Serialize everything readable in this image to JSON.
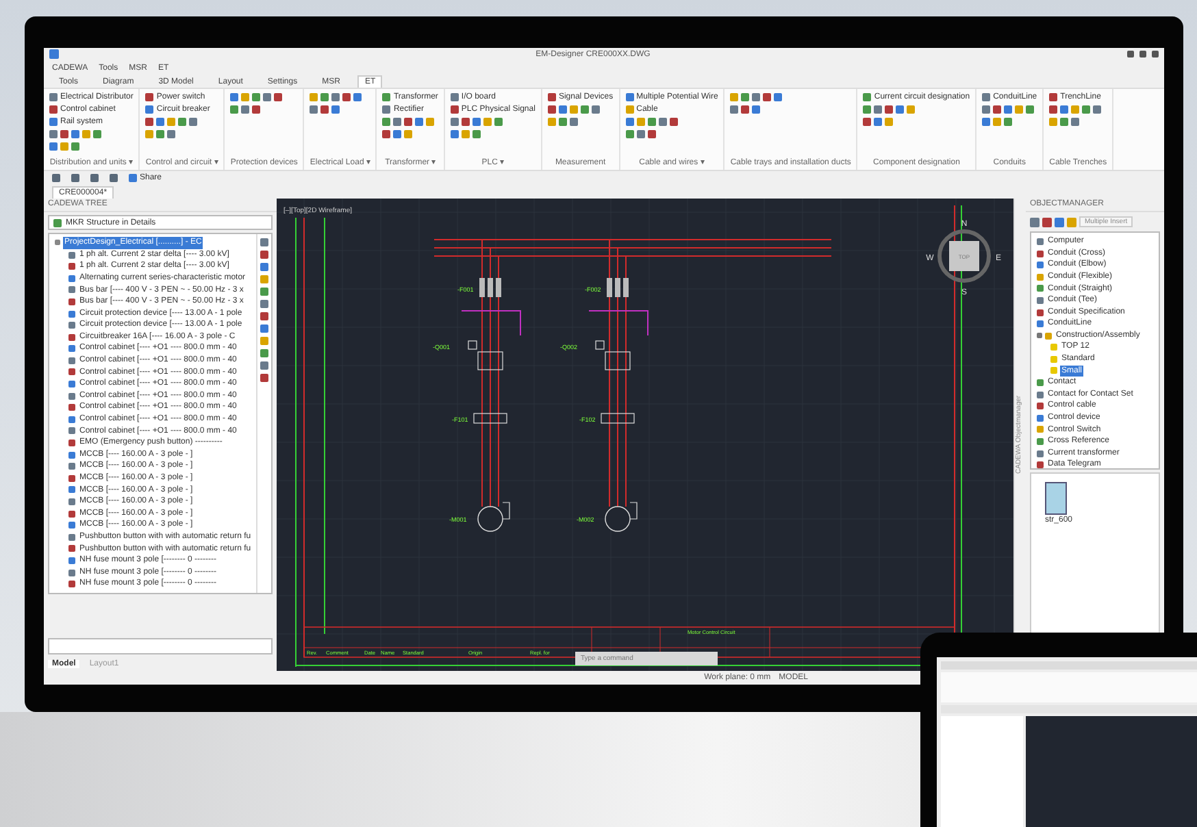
{
  "window": {
    "title": "EM-Designer  CRE000XX.DWG"
  },
  "menu": [
    "CADEWA",
    "Tools",
    "MSR",
    "ET"
  ],
  "ribbon_tabs": [
    {
      "label": "Tools",
      "selected": false
    },
    {
      "label": "Diagram",
      "selected": false
    },
    {
      "label": "3D Model",
      "selected": false
    },
    {
      "label": "Layout",
      "selected": false
    },
    {
      "label": "Settings",
      "selected": false
    },
    {
      "label": "MSR",
      "selected": false
    },
    {
      "label": "ET",
      "selected": true
    }
  ],
  "ribbon_groups": [
    {
      "label": "Distribution and units ▾",
      "items": [
        "Electrical Distributor",
        "Control cabinet",
        "Rail system"
      ]
    },
    {
      "label": "Control and circuit ▾",
      "items": [
        "Power switch",
        "Circuit breaker"
      ]
    },
    {
      "label": "Protection devices"
    },
    {
      "label": "Electrical Load ▾"
    },
    {
      "label": "Transformer ▾",
      "items": [
        "Transformer",
        "Rectifier"
      ]
    },
    {
      "label": "PLC ▾",
      "items": [
        "I/O board",
        "PLC Physical Signal"
      ]
    },
    {
      "label": "Measurement",
      "items": [
        "Signal Devices"
      ]
    },
    {
      "label": "Cable and wires ▾",
      "items": [
        "Multiple Potential Wire",
        "Cable"
      ]
    },
    {
      "label": "Cable trays and installation ducts"
    },
    {
      "label": "Component designation",
      "items": [
        "Current circuit designation"
      ]
    },
    {
      "label": "Conduits",
      "items": [
        "ConduitLine"
      ]
    },
    {
      "label": "Cable Trenches",
      "items": [
        "TrenchLine"
      ]
    }
  ],
  "quick_access": {
    "share": "Share"
  },
  "document_tabs": [
    {
      "label": "CRE000004*",
      "selected": true
    }
  ],
  "tree_panel": {
    "title": "CADEWA TREE",
    "structure": "MKR Structure in Details",
    "root": {
      "label": "ProjectDesign_Electrical  [..........] - EC",
      "selected": true,
      "expanded": true
    },
    "items": [
      "1 ph alt. Current 2 star delta   [---- 3.00 kV]",
      "1 ph alt. Current 2 star delta   [---- 3.00 kV]",
      "Alternating current series-characteristic motor",
      "Bus bar   [---- 400 V - 3 PEN ~ - 50.00 Hz - 3 x",
      "Bus bar   [---- 400 V - 3 PEN ~ - 50.00 Hz - 3 x",
      "Circuit protection device   [---- 13.00 A - 1 pole",
      "Circuit protection device   [---- 13.00 A - 1 pole",
      "Circuitbreaker 16A   [---- 16.00 A - 3 pole - C",
      "Control cabinet   [---- +O1 ---- 800.0 mm - 40",
      "Control cabinet   [---- +O1 ---- 800.0 mm - 40",
      "Control cabinet   [---- +O1 ---- 800.0 mm - 40",
      "Control cabinet   [---- +O1 ---- 800.0 mm - 40",
      "Control cabinet   [---- +O1 ---- 800.0 mm - 40",
      "Control cabinet   [---- +O1 ---- 800.0 mm - 40",
      "Control cabinet   [---- +O1 ---- 800.0 mm - 40",
      "Control cabinet   [---- +O1 ---- 800.0 mm - 40",
      "EMO   (Emergency push button) ----------",
      "MCCB   [---- 160.00 A - 3 pole - ]",
      "MCCB   [---- 160.00 A - 3 pole - ]",
      "MCCB   [---- 160.00 A - 3 pole - ]",
      "MCCB   [---- 160.00 A - 3 pole - ]",
      "MCCB   [---- 160.00 A - 3 pole - ]",
      "MCCB   [---- 160.00 A - 3 pole - ]",
      "MCCB   [---- 160.00 A - 3 pole - ]",
      "Pushbutton button with with automatic return fu",
      "Pushbutton button with with automatic return fu",
      "NH fuse mount 3 pole   [-------- 0 --------",
      "NH fuse mount 3 pole   [-------- 0 --------",
      "NH fuse mount 3 pole   [-------- 0 --------"
    ]
  },
  "canvas": {
    "viewport": "[–][Top][2D Wireframe]",
    "compass": {
      "north": "N",
      "west": "W",
      "east": "E",
      "south": "S",
      "top": "TOP"
    },
    "feeders": [
      {
        "fuse": "-F001",
        "breaker": "-Q001",
        "contactor": "-F101",
        "motor": "-M001"
      },
      {
        "fuse": "-F002",
        "breaker": "-Q002",
        "contactor": "-F102",
        "motor": "-M002"
      }
    ],
    "title_block": {
      "headers": [
        "Rev.",
        "Comment",
        "Date",
        "Name",
        "Standard",
        "Origin",
        "Repl. for"
      ],
      "title": "Motor Control Circuit"
    },
    "command": {
      "placeholder": "Type a command"
    }
  },
  "object_manager": {
    "side_label": "CADEWA Objectmanager",
    "title": "OBJECTMANAGER",
    "button": "Multiple Insert",
    "items": [
      {
        "label": "Computer",
        "selected": false
      },
      {
        "label": "Conduit (Cross)",
        "selected": false
      },
      {
        "label": "Conduit (Elbow)",
        "selected": false
      },
      {
        "label": "Conduit (Flexible)",
        "selected": false
      },
      {
        "label": "Conduit (Straight)",
        "selected": false
      },
      {
        "label": "Conduit (Tee)",
        "selected": false
      },
      {
        "label": "Conduit Specification",
        "selected": false
      },
      {
        "label": "ConduitLine",
        "selected": false
      },
      {
        "label": "Construction/Assembly",
        "selected": false,
        "expanded": true,
        "children": [
          {
            "label": "TOP 12",
            "selected": false
          },
          {
            "label": "Standard",
            "selected": false
          },
          {
            "label": "Small",
            "selected": true
          }
        ]
      },
      {
        "label": "Contact",
        "selected": false
      },
      {
        "label": "Contact for Contact Set",
        "selected": false
      },
      {
        "label": "Control cable",
        "selected": false
      },
      {
        "label": "Control device",
        "selected": false
      },
      {
        "label": "Control Switch",
        "selected": false
      },
      {
        "label": "Cross Reference",
        "selected": false
      },
      {
        "label": "Current transformer",
        "selected": false
      },
      {
        "label": "Data Telegram",
        "selected": false
      }
    ],
    "preview_label": "str_600"
  },
  "layout_tabs": [
    {
      "label": "Model",
      "selected": true
    },
    {
      "label": "Layout1",
      "selected": false
    }
  ],
  "status_bar": {
    "work_plane": "Work plane: 0 mm",
    "mode": "MODEL"
  }
}
